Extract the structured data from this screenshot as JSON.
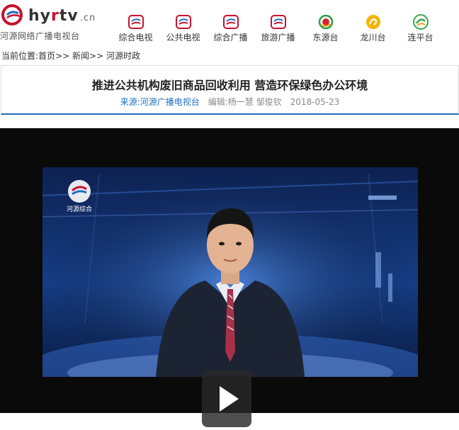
{
  "site": {
    "logo_prefix": "hy",
    "logo_r": "r",
    "logo_suffix": "tv",
    "logo_domain": ".cn",
    "logo_subtitle": "河源网络广播电视台"
  },
  "nav": {
    "items": [
      {
        "label": "综合电视",
        "icon": "tv-channel-icon"
      },
      {
        "label": "公共电视",
        "icon": "public-tv-icon"
      },
      {
        "label": "综合广播",
        "icon": "radio-icon"
      },
      {
        "label": "旅游广播",
        "icon": "travel-radio-icon"
      },
      {
        "label": "东源台",
        "icon": "dongyuan-icon"
      },
      {
        "label": "龙川台",
        "icon": "longchuan-icon"
      },
      {
        "label": "连平台",
        "icon": "lianping-icon"
      }
    ]
  },
  "breadcrumb": {
    "prefix": "当前位置:",
    "items": [
      "首页",
      "新闻",
      "河源时政"
    ],
    "separator": ">>"
  },
  "article": {
    "title": "推进公共机构废旧商品回收利用 营造环保绿色办公环境",
    "source": "来源:河源广播电视台",
    "editor": "编辑:杨一慧 邹俊钦",
    "date": "2018-05-23"
  },
  "video": {
    "channel_logo_text": "河源综合",
    "play_icon": "play-icon"
  },
  "colors": {
    "accent_blue": "#1f6fc1",
    "brand_red": "#c8102e"
  }
}
